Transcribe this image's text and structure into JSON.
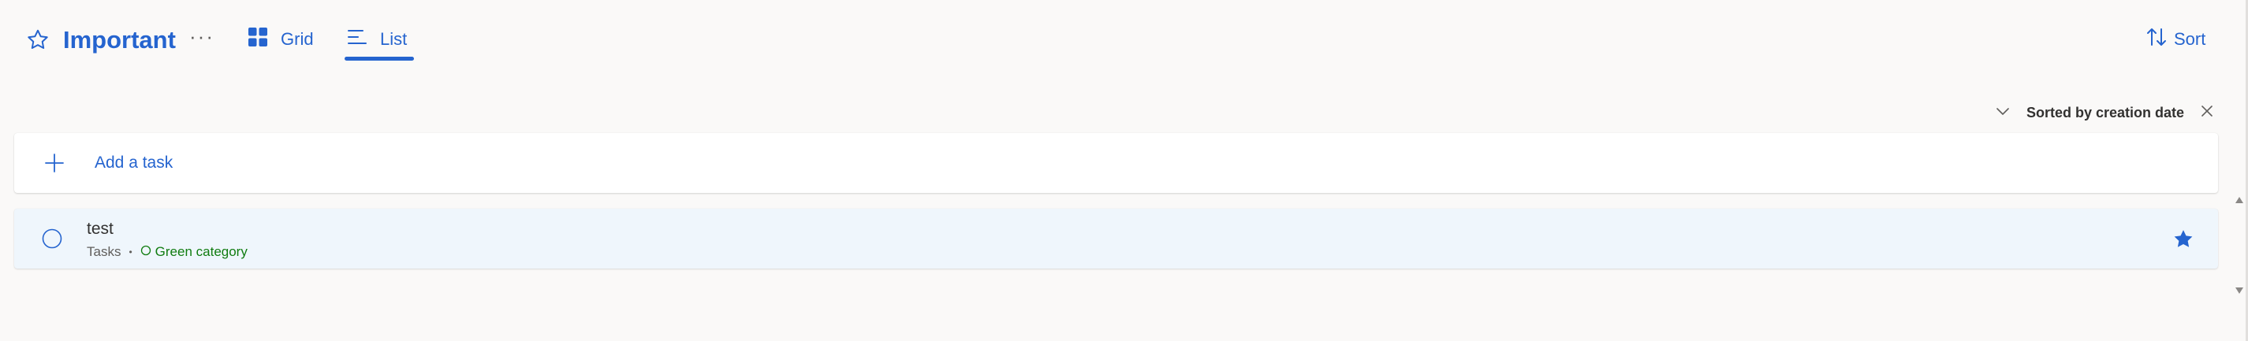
{
  "header": {
    "title": "Important",
    "title_icon": "star-outline-icon",
    "more_label": "···",
    "views": [
      {
        "label": "Grid",
        "icon": "grid-icon"
      },
      {
        "label": "List",
        "icon": "list-icon",
        "selected": true
      }
    ],
    "sort_label": "Sort",
    "sort_icon": "sort-arrows-icon"
  },
  "sorting": {
    "label": "Sorted by creation date",
    "expand_icon": "chevron-down-icon",
    "clear_icon": "close-icon"
  },
  "add_task": {
    "label": "Add a task",
    "icon": "plus-icon"
  },
  "tasks": [
    {
      "title": "test",
      "list": "Tasks",
      "separator": "•",
      "category": "Green category",
      "important": true
    }
  ],
  "colors": {
    "accent": "#2564cf",
    "background": "#faf9f8",
    "task_row": "#eff6fc",
    "category_green": "#107c10"
  }
}
